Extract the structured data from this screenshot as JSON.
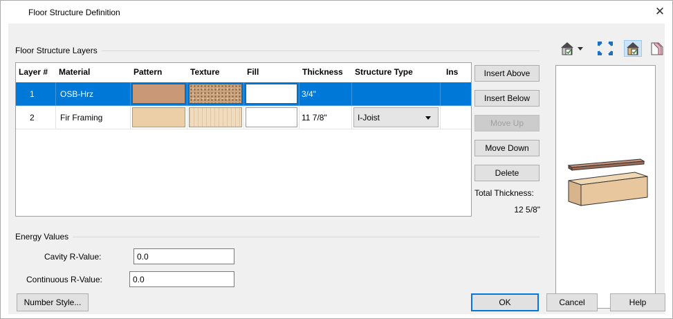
{
  "window": {
    "title": "Floor Structure Definition",
    "close_glyph": "✕"
  },
  "layers_group": {
    "label": "Floor Structure Layers"
  },
  "table": {
    "headers": [
      "Layer #",
      "Material",
      "Pattern",
      "Texture",
      "Fill",
      "Thickness",
      "Structure Type",
      "Ins"
    ],
    "rows": [
      {
        "layer": "1",
        "material": "OSB-Hrz",
        "thickness": "3/4\"",
        "structure_type": ""
      },
      {
        "layer": "2",
        "material": "Fir Framing",
        "thickness": "11 7/8\"",
        "structure_type": "I-Joist"
      }
    ]
  },
  "side_buttons": {
    "insert_above": "Insert Above",
    "insert_below": "Insert Below",
    "move_up": "Move Up",
    "move_down": "Move Down",
    "delete": "Delete"
  },
  "total_thickness": {
    "label": "Total Thickness:",
    "value": "12 5/8\""
  },
  "energy_group": {
    "label": "Energy Values",
    "cavity_label": "Cavity R-Value:",
    "cavity_value": "0.0",
    "continuous_label": "Continuous R-Value:",
    "continuous_value": "0.0"
  },
  "footer": {
    "number_style": "Number Style...",
    "ok": "OK",
    "cancel": "Cancel",
    "help": "Help"
  },
  "colors": {
    "selection": "#0078d7",
    "osb_pattern": "#c89877",
    "fir_pattern": "#eccfa6"
  }
}
